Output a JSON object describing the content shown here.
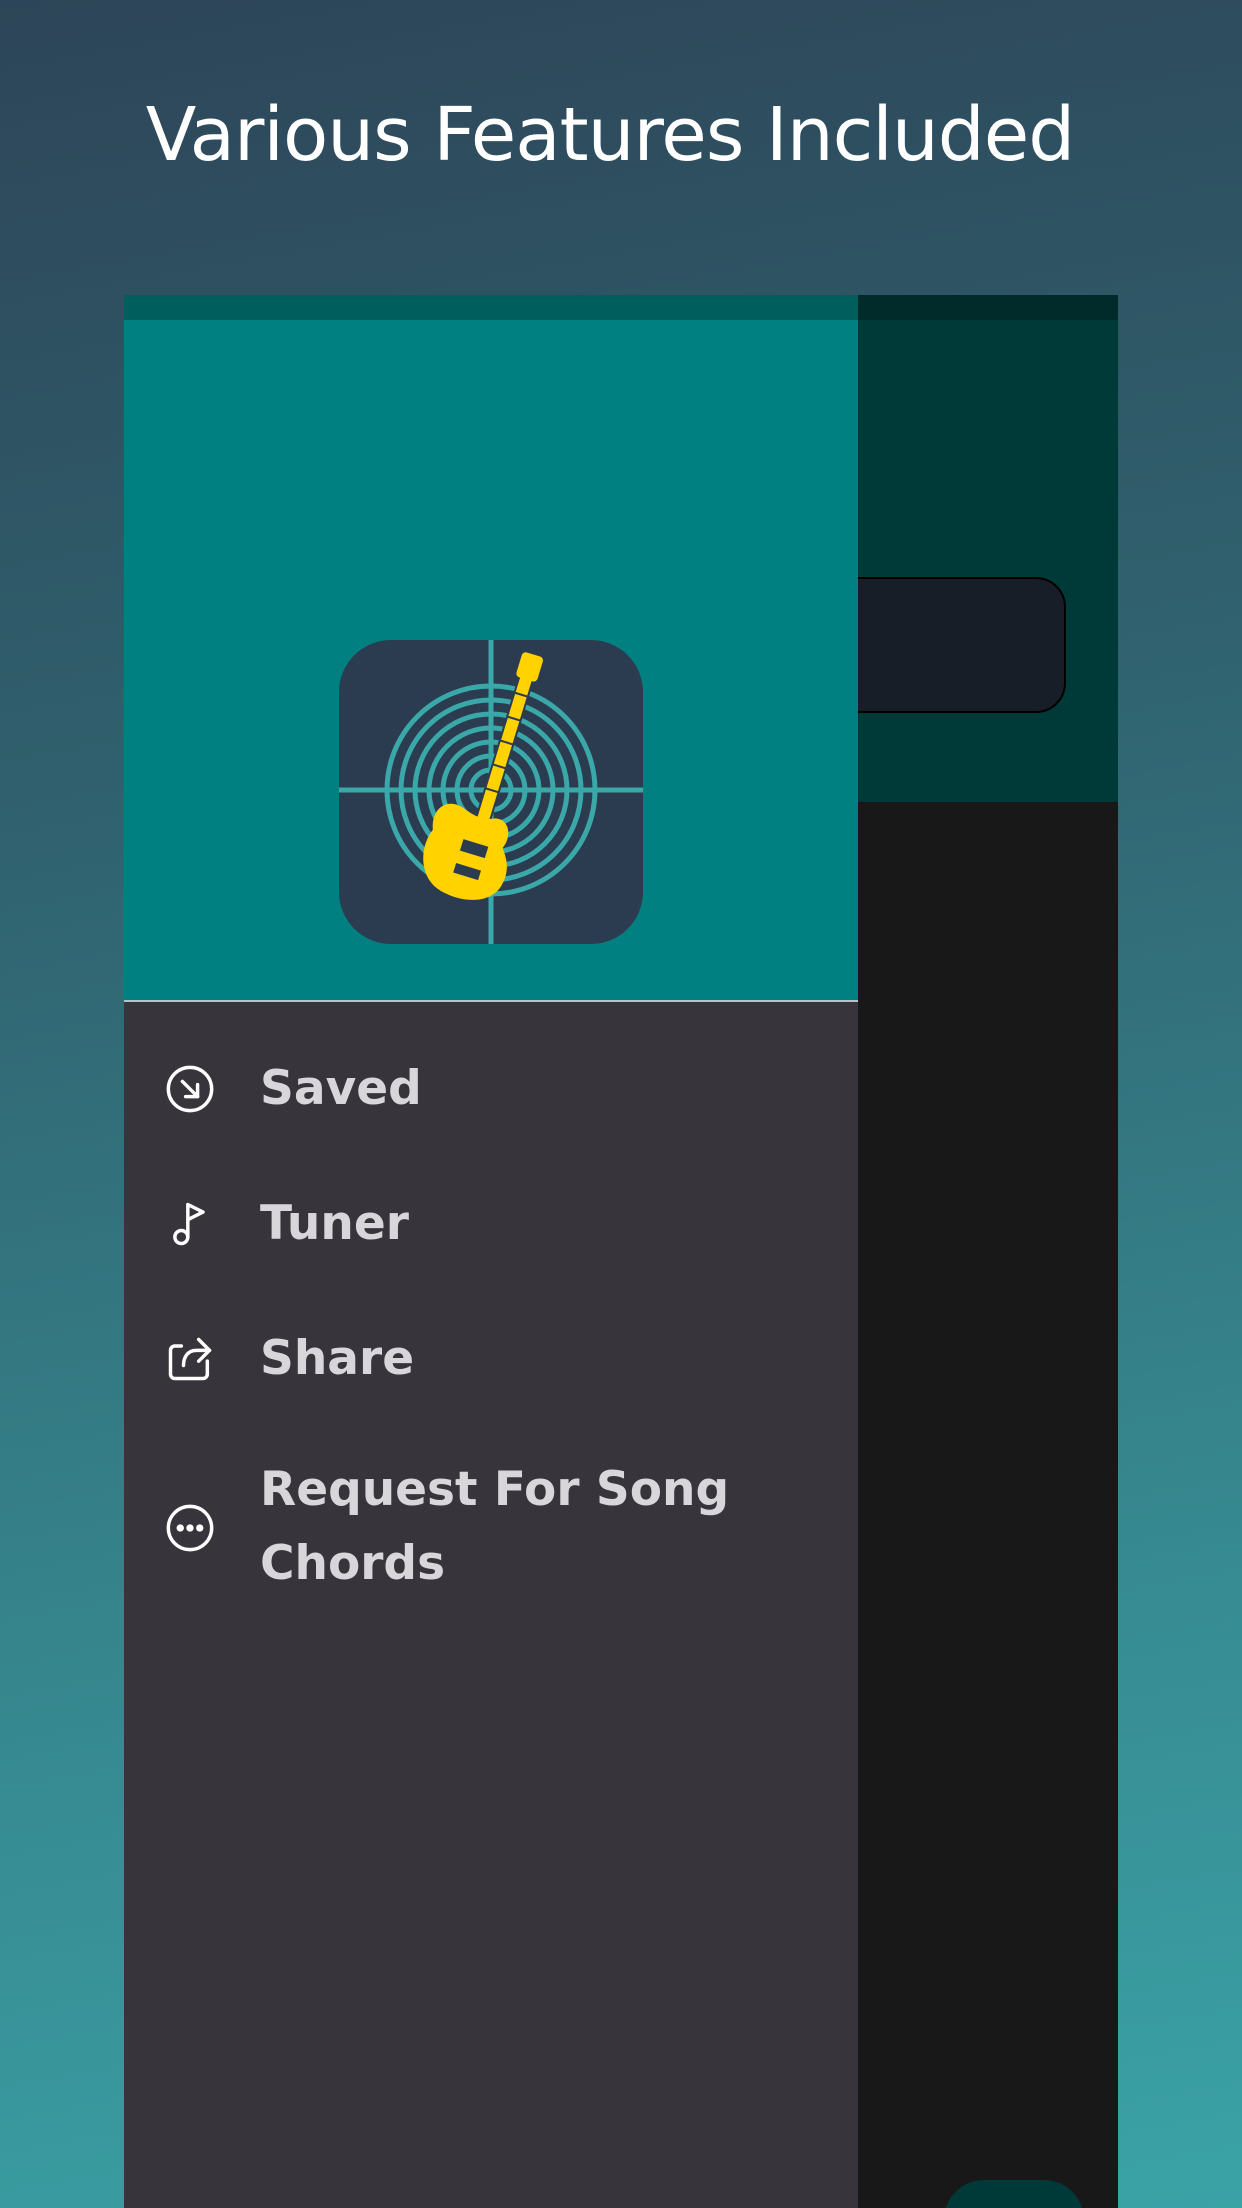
{
  "headline": "Various Features Included",
  "colors": {
    "header_teal": "#008080",
    "drawer_bg": "#37343c",
    "menu_text": "#d9d6db",
    "logo_accent": "#ffd200"
  },
  "logo": {
    "icon": "guitar-target-icon"
  },
  "menu": {
    "items": [
      {
        "label": "Saved",
        "icon": "arrow-down-right-circle-icon"
      },
      {
        "label": "Tuner",
        "icon": "music-note-icon"
      },
      {
        "label": "Share",
        "icon": "share-icon"
      },
      {
        "label": "Request For Song Chords",
        "icon": "more-horizontal-circle-icon"
      }
    ]
  }
}
